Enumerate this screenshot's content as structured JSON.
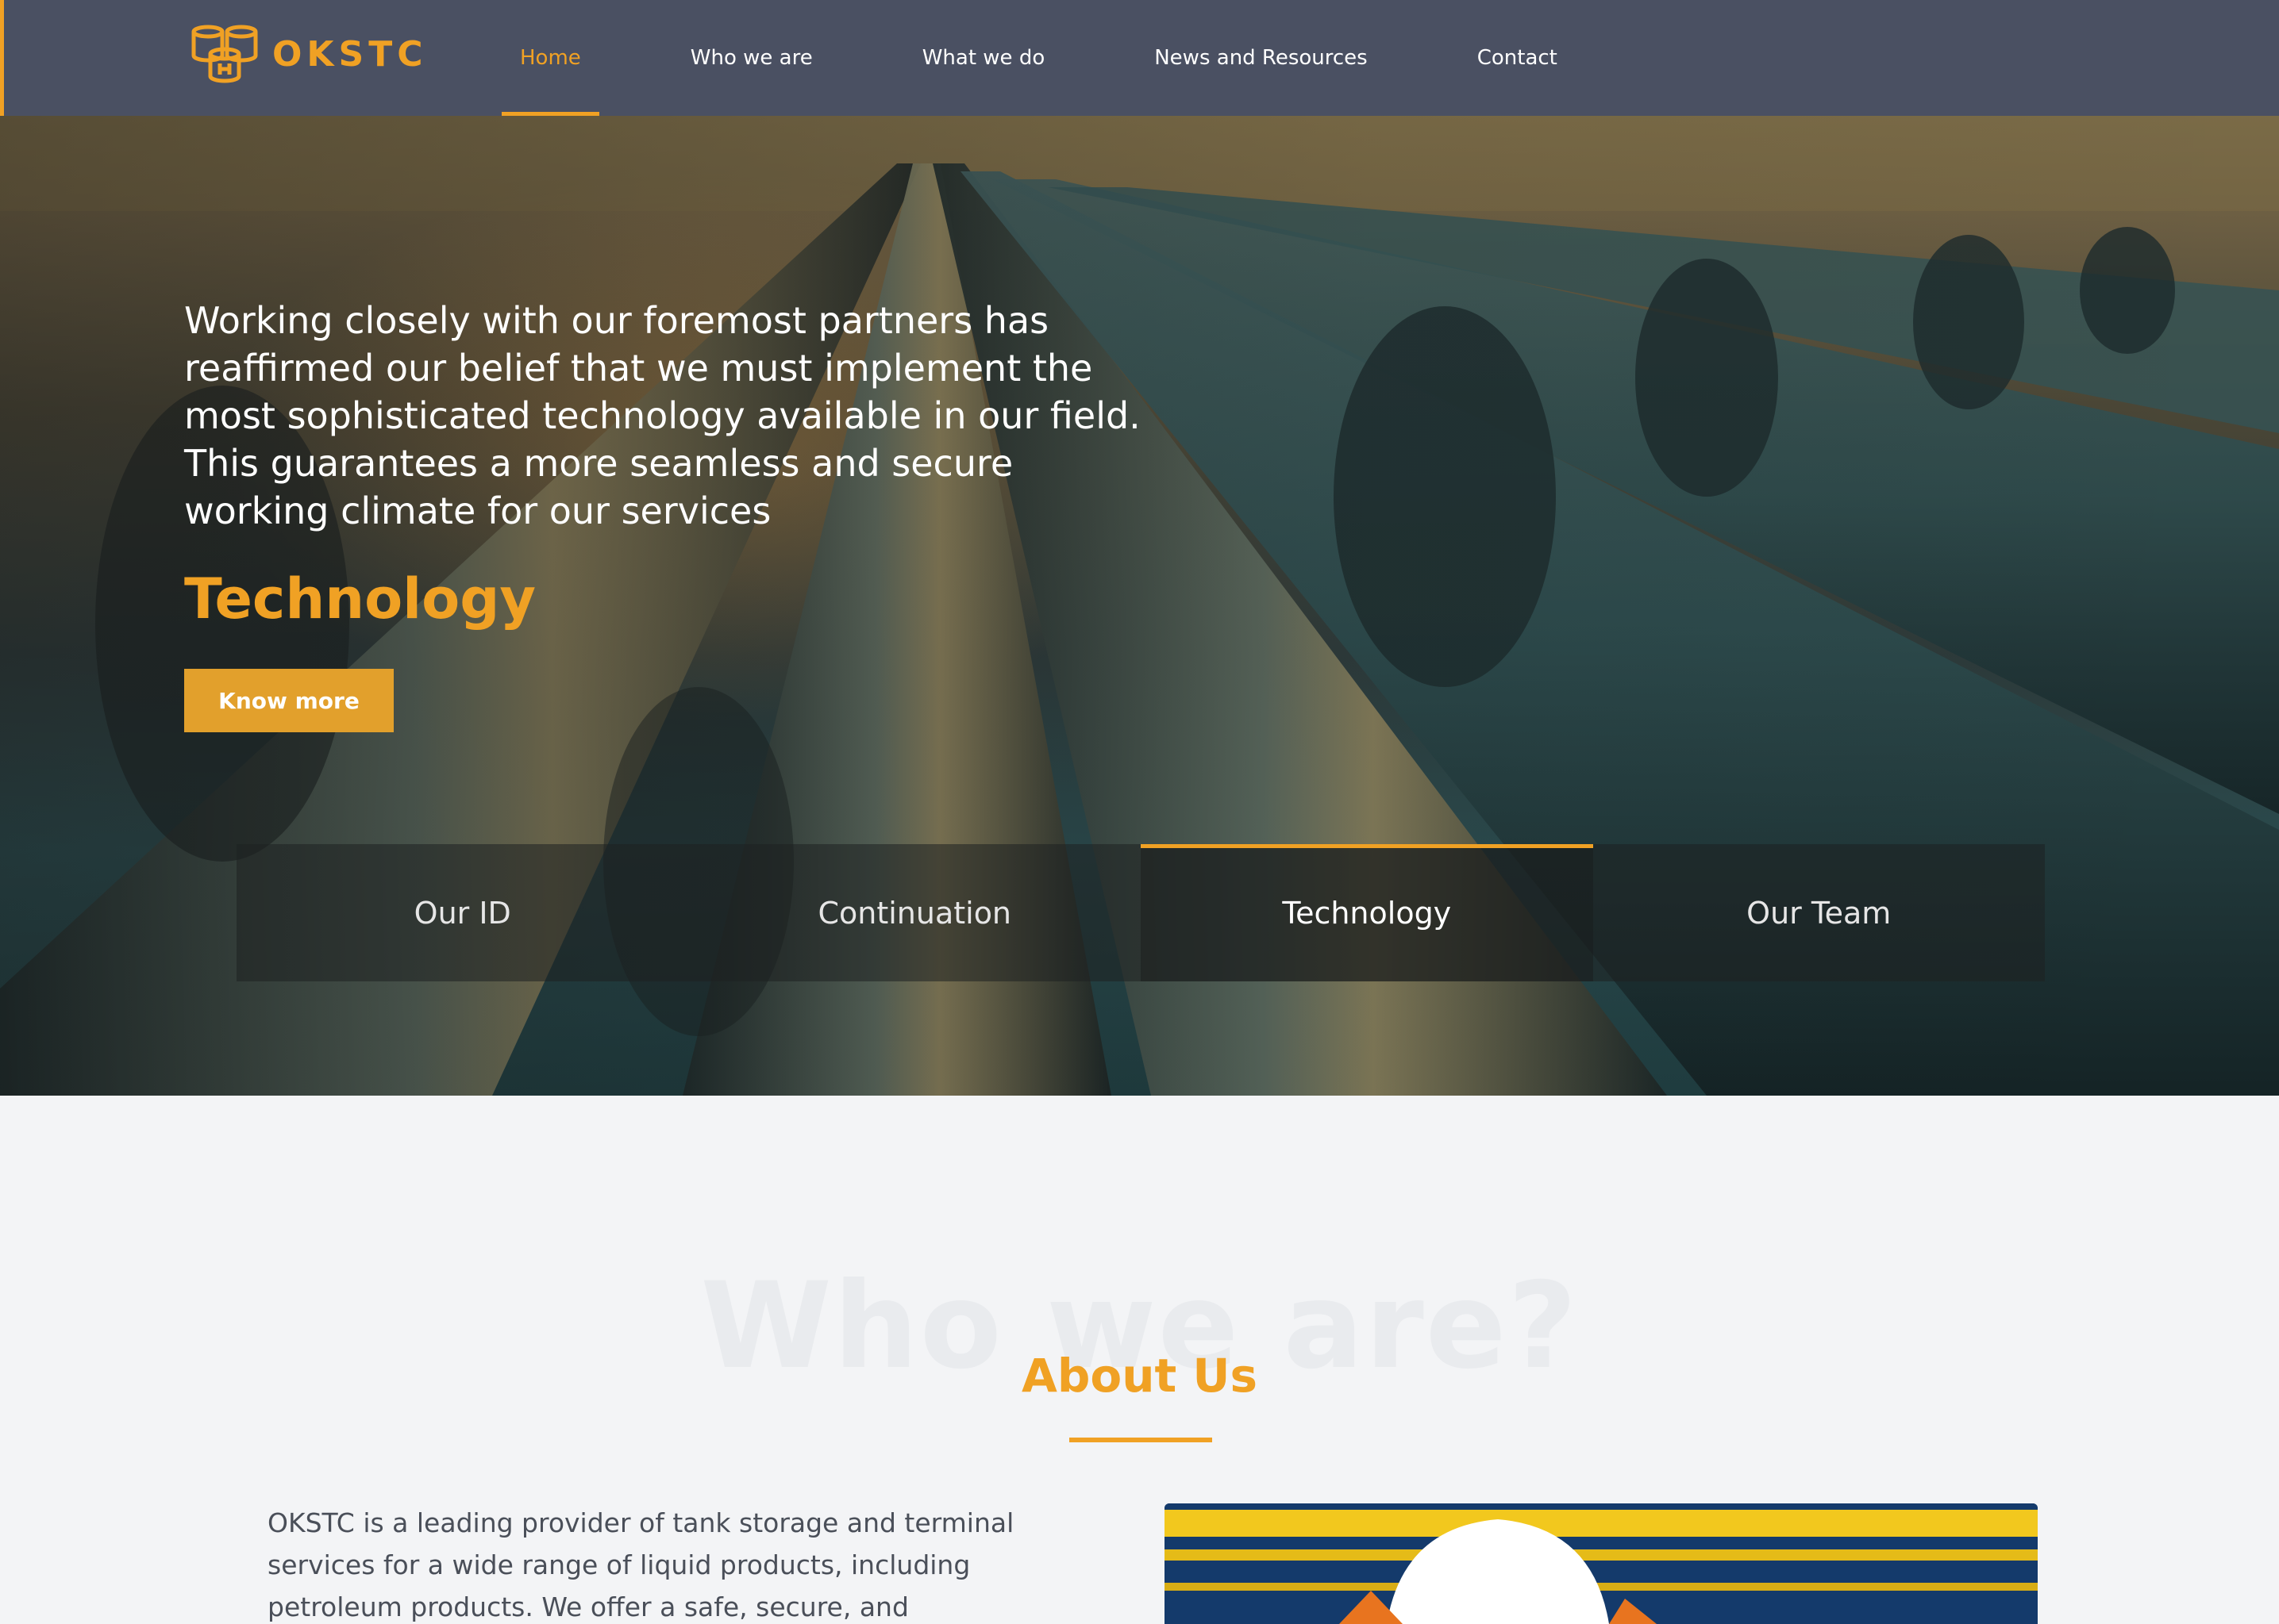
{
  "brand": {
    "name": "OKSTC",
    "logo_icon": "oil-barrels-icon",
    "accent_color": "#f0a124",
    "header_color": "#4a5062"
  },
  "nav": {
    "items": [
      {
        "label": "Home",
        "active": true
      },
      {
        "label": "Who we are",
        "active": false
      },
      {
        "label": "What we do",
        "active": false
      },
      {
        "label": "News and Resources",
        "active": false
      },
      {
        "label": "Contact",
        "active": false
      }
    ]
  },
  "hero": {
    "text": "Working closely with our foremost partners has reaffirmed our belief that we must implement the most sophisticated technology available in our field. This guarantees a more seamless and secure working climate for our services",
    "title": "Technology",
    "button_label": "Know more",
    "tabs": [
      {
        "label": "Our ID",
        "active": false
      },
      {
        "label": "Continuation",
        "active": false
      },
      {
        "label": "Technology",
        "active": true
      },
      {
        "label": "Our Team",
        "active": false
      }
    ]
  },
  "about": {
    "background_title": "Who we are?",
    "title": "About Us",
    "text": "OKSTC is a leading provider of tank storage and terminal services for a wide range of liquid products, including petroleum products. We offer a safe, secure, and"
  }
}
